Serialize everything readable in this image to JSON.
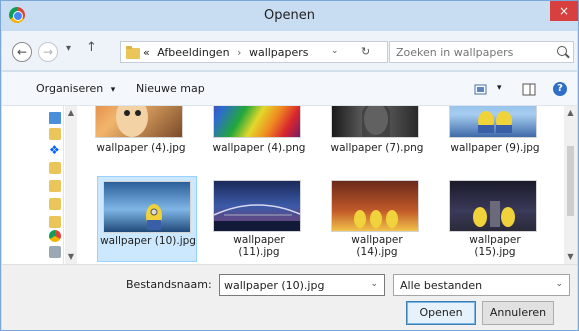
{
  "window": {
    "title": "Openen",
    "close_glyph": "×"
  },
  "nav": {
    "back_glyph": "←",
    "forward_glyph": "→",
    "recent_glyph": "▾",
    "up_glyph": "↑",
    "breadcrumb": {
      "overflow": "«",
      "folder": "Afbeeldingen",
      "separator": "›",
      "current": "wallpapers"
    },
    "address_dropdown": "⌄",
    "refresh_glyph": "↻",
    "search_placeholder": "Zoeken in wallpapers"
  },
  "toolbar": {
    "organize": "Organiseren",
    "organize_arrow": "▾",
    "new_folder": "Nieuwe map",
    "view_arrow": "▾",
    "help_glyph": "?"
  },
  "files": [
    {
      "name": "wallpaper (4).jpg",
      "selected": false
    },
    {
      "name": "wallpaper (4).png",
      "selected": false
    },
    {
      "name": "wallpaper (7).png",
      "selected": false
    },
    {
      "name": "wallpaper (9).jpg",
      "selected": false
    },
    {
      "name": "wallpaper (10).jpg",
      "selected": true
    },
    {
      "name": "wallpaper (11).jpg",
      "selected": false
    },
    {
      "name": "wallpaper (14).jpg",
      "selected": false
    },
    {
      "name": "wallpaper (15).jpg",
      "selected": false
    }
  ],
  "filename": {
    "label": "Bestandsnaam:",
    "value": "wallpaper (10).jpg",
    "dropdown": "⌄"
  },
  "filetype": {
    "value": "Alle bestanden",
    "dropdown": "⌄"
  },
  "buttons": {
    "open": "Openen",
    "cancel": "Annuleren"
  },
  "scroll": {
    "up": "▲",
    "down": "▼"
  },
  "colors": {
    "selection_fill": "#cce8ff",
    "selection_border": "#99d1ff",
    "close_red": "#d84040",
    "titlebar": "#c8dcf2"
  },
  "icons": [
    "chrome-icon",
    "folder-icon",
    "search-icon",
    "view-icon",
    "preview-pane-icon",
    "help-icon",
    "desktop-icon",
    "libraries-icon",
    "dropbox-icon"
  ]
}
